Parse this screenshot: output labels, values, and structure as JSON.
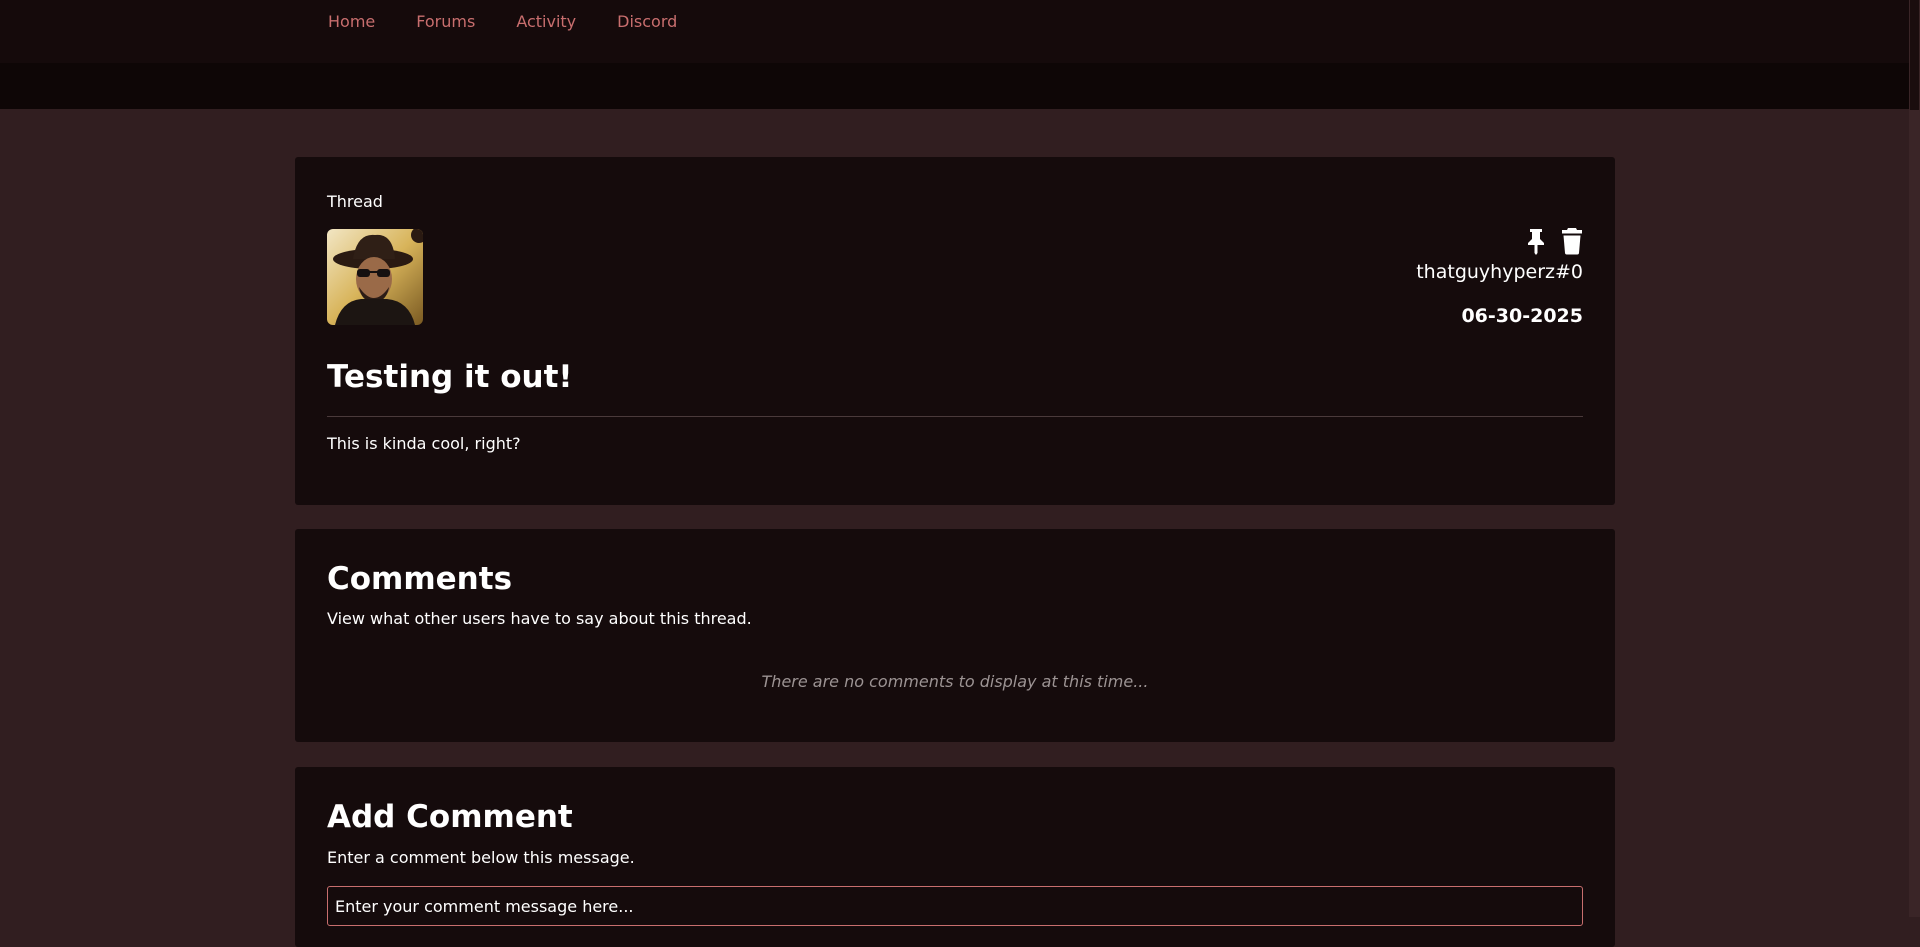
{
  "nav": {
    "items": [
      {
        "label": "Home"
      },
      {
        "label": "Forums"
      },
      {
        "label": "Activity"
      },
      {
        "label": "Discord"
      }
    ]
  },
  "thread": {
    "label": "Thread",
    "author": "thatguyhyperz#0",
    "date": "06-30-2025",
    "title": "Testing it out!",
    "body": "This is kinda cool, right?",
    "actions": [
      {
        "icon": "pin-icon"
      },
      {
        "icon": "trash-icon"
      }
    ]
  },
  "comments": {
    "title": "Comments",
    "subtitle": "View what other users have to say about this thread.",
    "empty_message": "There are no comments to display at this time..."
  },
  "add_comment": {
    "title": "Add Comment",
    "subtitle": "Enter a comment below this message.",
    "placeholder": "Enter your comment message here..."
  },
  "colors": {
    "page_bg": "#311e20",
    "card_bg": "#150b0c",
    "nav_link": "#c86e6e",
    "input_border": "#c86e6e"
  }
}
